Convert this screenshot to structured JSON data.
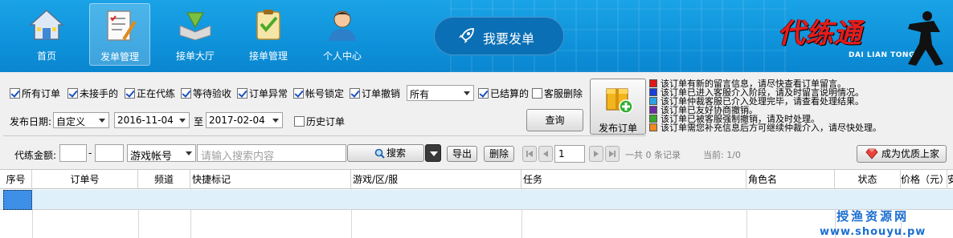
{
  "nav": {
    "items": [
      {
        "label": "首页",
        "icon": "home-icon"
      },
      {
        "label": "发单管理",
        "icon": "order-list-icon"
      },
      {
        "label": "接单大厅",
        "icon": "hall-icon"
      },
      {
        "label": "接单管理",
        "icon": "checklist-icon"
      },
      {
        "label": "个人中心",
        "icon": "user-icon"
      }
    ],
    "active_index": 1,
    "publish_button": "我要发单",
    "logo_text": "代练通",
    "logo_subtext": "DAI LIAN TONG"
  },
  "filters": {
    "checkboxes": [
      {
        "label": "所有订单",
        "checked": true
      },
      {
        "label": "未接手的",
        "checked": true
      },
      {
        "label": "正在代练",
        "checked": true
      },
      {
        "label": "等待验收",
        "checked": true
      },
      {
        "label": "订单异常",
        "checked": true
      },
      {
        "label": "帐号锁定",
        "checked": true
      },
      {
        "label": "订单撤销",
        "checked": true
      }
    ],
    "status_select": "所有",
    "settled": {
      "label": "已结算的",
      "checked": true
    },
    "cs_delete": {
      "label": "客服删除",
      "checked": false
    },
    "date_label": "发布日期:",
    "date_mode": "自定义",
    "date_from": "2016-11-04",
    "date_to_label": "至",
    "date_to": "2017-02-04",
    "history": {
      "label": "历史订单",
      "checked": false
    },
    "query_button": "查询",
    "amount_label": "代练金额:",
    "amount_dash": "-",
    "account_select": "游戏帐号",
    "search_placeholder": "请输入搜索内容",
    "search_button": "搜索",
    "export_button": "导出",
    "delete_button": "删除",
    "page_value": "1",
    "record_count": "一共 0 条记录",
    "current_page": "当前: 1/0",
    "publish_order_button": "发布订单",
    "premium_button": "成为优质上家"
  },
  "legend": [
    {
      "color": "#e01818",
      "text": "该订单有新的留言信息，请尽快查看订单留言。"
    },
    {
      "color": "#1a3fd8",
      "text": "该订单已进入客服介入阶段，请及时留言说明情况。"
    },
    {
      "color": "#29a3e8",
      "text": "该订单仲裁客服已介入处理完毕，请查看处理结果。"
    },
    {
      "color": "#6a2ca8",
      "text": "该订单已友好协商撤销。"
    },
    {
      "color": "#3aa82c",
      "text": "该订单已被客服强制撤销，请及时处理。"
    },
    {
      "color": "#f08a1c",
      "text": "该订单需您补充信息后方可继续仲裁介入，请尽快处理。"
    }
  ],
  "table": {
    "columns": [
      "序号",
      "订单号",
      "频道",
      "快捷标记",
      "游戏/区/服",
      "任务",
      "角色名",
      "状态",
      "价格（元）",
      "安"
    ]
  },
  "watermark": {
    "line1": "授渔资源网",
    "line2": "www.shouyu.pw"
  }
}
